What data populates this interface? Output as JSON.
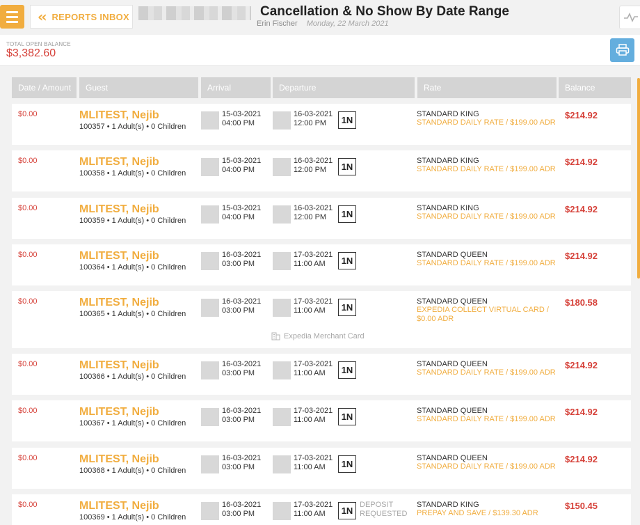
{
  "header": {
    "back_label": "REPORTS INBOX",
    "title": "Cancellation & No Show By Date Range",
    "user": "Erin Fischer",
    "date": "Monday, 22 March 2021"
  },
  "summary": {
    "label": "TOTAL OPEN BALANCE",
    "value": "$3,382.60"
  },
  "columns": [
    "Date / Amount",
    "Guest",
    "Arrival",
    "Departure",
    "Rate",
    "Balance"
  ],
  "rows": [
    {
      "amount": "$0.00",
      "guest": "MLITEST, Nejib",
      "info": "100357 • 1 Adult(s) • 0 Children",
      "arr_date": "15-03-2021",
      "arr_time": "04:00 PM",
      "dep_date": "16-03-2021",
      "dep_time": "12:00 PM",
      "nights": "1N",
      "room": "STANDARD KING",
      "rate1": "STANDARD DAILY RATE / $199.00 ADR",
      "rate2": "",
      "balance": "$214.92",
      "dep1": "",
      "dep2": "",
      "merchant": ""
    },
    {
      "amount": "$0.00",
      "guest": "MLITEST, Nejib",
      "info": "100358 • 1 Adult(s) • 0 Children",
      "arr_date": "15-03-2021",
      "arr_time": "04:00 PM",
      "dep_date": "16-03-2021",
      "dep_time": "12:00 PM",
      "nights": "1N",
      "room": "STANDARD KING",
      "rate1": "STANDARD DAILY RATE / $199.00 ADR",
      "rate2": "",
      "balance": "$214.92",
      "dep1": "",
      "dep2": "",
      "merchant": ""
    },
    {
      "amount": "$0.00",
      "guest": "MLITEST, Nejib",
      "info": "100359 • 1 Adult(s) • 0 Children",
      "arr_date": "15-03-2021",
      "arr_time": "04:00 PM",
      "dep_date": "16-03-2021",
      "dep_time": "12:00 PM",
      "nights": "1N",
      "room": "STANDARD KING",
      "rate1": "STANDARD DAILY RATE / $199.00 ADR",
      "rate2": "",
      "balance": "$214.92",
      "dep1": "",
      "dep2": "",
      "merchant": ""
    },
    {
      "amount": "$0.00",
      "guest": "MLITEST, Nejib",
      "info": "100364 • 1 Adult(s) • 0 Children",
      "arr_date": "16-03-2021",
      "arr_time": "03:00 PM",
      "dep_date": "17-03-2021",
      "dep_time": "11:00 AM",
      "nights": "1N",
      "room": "STANDARD QUEEN",
      "rate1": "STANDARD DAILY RATE / $199.00 ADR",
      "rate2": "",
      "balance": "$214.92",
      "dep1": "",
      "dep2": "",
      "merchant": ""
    },
    {
      "amount": "$0.00",
      "guest": "MLITEST, Nejib",
      "info": "100365 • 1 Adult(s) • 0 Children",
      "arr_date": "16-03-2021",
      "arr_time": "03:00 PM",
      "dep_date": "17-03-2021",
      "dep_time": "11:00 AM",
      "nights": "1N",
      "room": "STANDARD QUEEN",
      "rate1": "EXPEDIA COLLECT VIRTUAL CARD /",
      "rate2": "$0.00 ADR",
      "balance": "$180.58",
      "dep1": "",
      "dep2": "",
      "merchant": "Expedia Merchant Card"
    },
    {
      "amount": "$0.00",
      "guest": "MLITEST, Nejib",
      "info": "100366 • 1 Adult(s) • 0 Children",
      "arr_date": "16-03-2021",
      "arr_time": "03:00 PM",
      "dep_date": "17-03-2021",
      "dep_time": "11:00 AM",
      "nights": "1N",
      "room": "STANDARD QUEEN",
      "rate1": "STANDARD DAILY RATE / $199.00 ADR",
      "rate2": "",
      "balance": "$214.92",
      "dep1": "",
      "dep2": "",
      "merchant": ""
    },
    {
      "amount": "$0.00",
      "guest": "MLITEST, Nejib",
      "info": "100367 • 1 Adult(s) • 0 Children",
      "arr_date": "16-03-2021",
      "arr_time": "03:00 PM",
      "dep_date": "17-03-2021",
      "dep_time": "11:00 AM",
      "nights": "1N",
      "room": "STANDARD QUEEN",
      "rate1": "STANDARD DAILY RATE / $199.00 ADR",
      "rate2": "",
      "balance": "$214.92",
      "dep1": "",
      "dep2": "",
      "merchant": ""
    },
    {
      "amount": "$0.00",
      "guest": "MLITEST, Nejib",
      "info": "100368 • 1 Adult(s) • 0 Children",
      "arr_date": "16-03-2021",
      "arr_time": "03:00 PM",
      "dep_date": "17-03-2021",
      "dep_time": "11:00 AM",
      "nights": "1N",
      "room": "STANDARD QUEEN",
      "rate1": "STANDARD DAILY RATE / $199.00 ADR",
      "rate2": "",
      "balance": "$214.92",
      "dep1": "",
      "dep2": "",
      "merchant": ""
    },
    {
      "amount": "$0.00",
      "guest": "MLITEST, Nejib",
      "info": "100369 • 1 Adult(s) • 0 Children",
      "arr_date": "16-03-2021",
      "arr_time": "03:00 PM",
      "dep_date": "17-03-2021",
      "dep_time": "11:00 AM",
      "nights": "1N",
      "room": "STANDARD KING",
      "rate1": "PREPAY AND SAVE / $139.30 ADR",
      "rate2": "",
      "balance": "$150.45",
      "dep1": "DEPOSIT",
      "dep2": "REQUESTED",
      "merchant": ""
    }
  ],
  "colors": {
    "accent": "#f1ad3f",
    "negative": "#d6423a",
    "print_button": "#64aede",
    "header_cells": "#d4d4d4"
  },
  "icons": [
    "menu-icon",
    "double-chevron-left-icon",
    "pulse-icon",
    "print-icon",
    "building-icon"
  ]
}
